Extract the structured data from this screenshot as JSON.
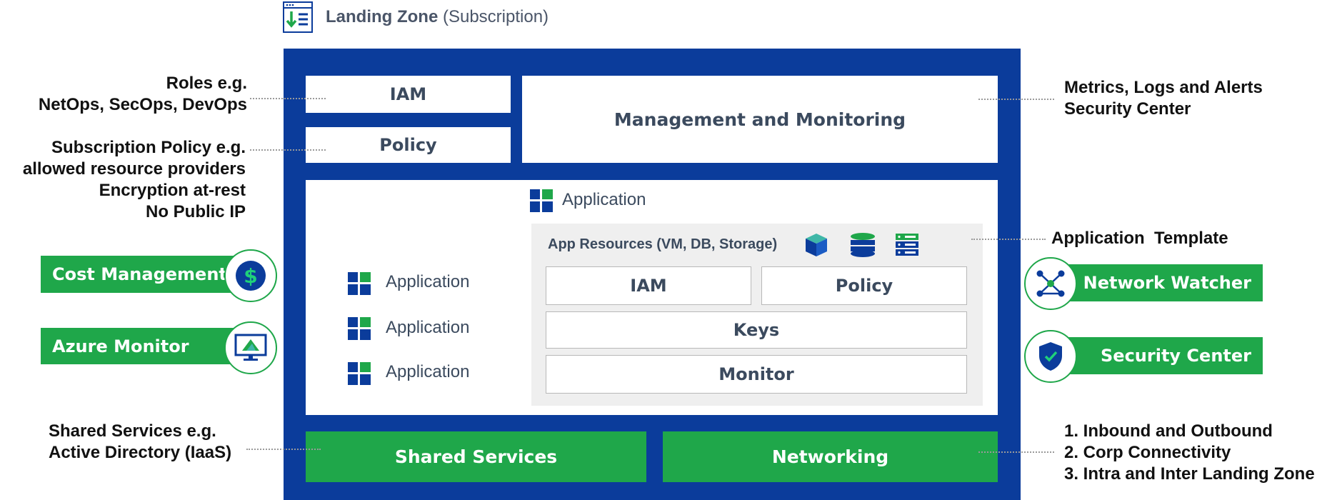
{
  "header": {
    "title": "Landing Zone",
    "subtitle": "(Subscription)",
    "icon": "landing-zone-icon"
  },
  "top": {
    "iam": "IAM",
    "policy": "Policy",
    "management": "Management and Monitoring"
  },
  "application_area": {
    "main_app_label": "Application",
    "side_apps": [
      "Application",
      "Application",
      "Application"
    ],
    "app_resources": "App Resources (VM, DB, Storage)",
    "resource_icons": [
      "cube-icon",
      "database-icon",
      "server-icon"
    ],
    "inner_iam": "IAM",
    "inner_policy": "Policy",
    "keys": "Keys",
    "monitor": "Monitor"
  },
  "bottom": {
    "shared_services": "Shared Services",
    "networking": "Networking"
  },
  "left_notes": {
    "roles": [
      "Roles e.g.",
      "NetOps, SecOps, DevOps"
    ],
    "policy": [
      "Subscription Policy e.g.",
      "allowed resource providers",
      "Encryption at-rest",
      "No Public IP"
    ],
    "shared": [
      "Shared Services e.g.",
      "Active Directory (IaaS)"
    ]
  },
  "right_notes": {
    "metrics": [
      "Metrics, Logs and Alerts",
      "Security Center"
    ],
    "app_template": "Application  Template",
    "networking": [
      "1. Inbound and Outbound",
      "2. Corp Connectivity",
      "3. Intra and Inter Landing Zone"
    ]
  },
  "left_tools": [
    {
      "label": "Cost Management",
      "icon": "dollar-icon"
    },
    {
      "label": "Azure Monitor",
      "icon": "monitor-icon"
    }
  ],
  "right_tools": [
    {
      "label": "Network Watcher",
      "icon": "network-icon"
    },
    {
      "label": "Security Center",
      "icon": "shield-icon"
    }
  ],
  "colors": {
    "navy": "#0b3c9b",
    "green": "#1fa74a",
    "grey_panel": "#efefef"
  }
}
